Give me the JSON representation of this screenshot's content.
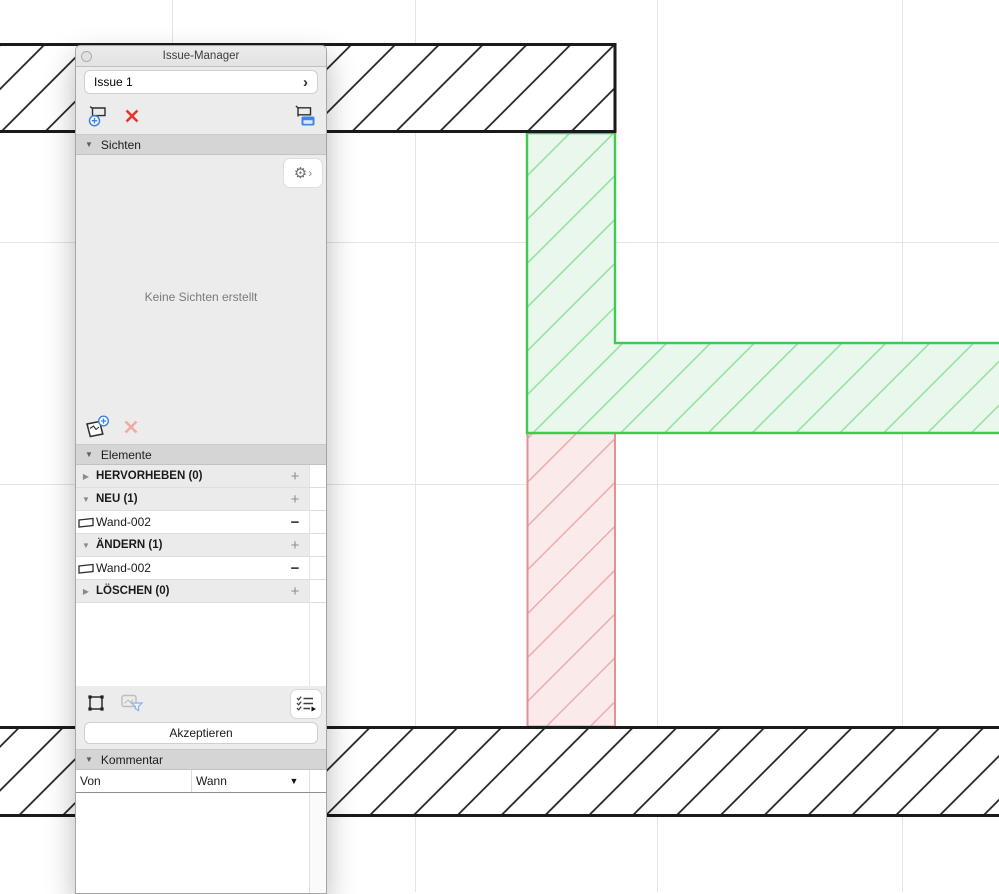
{
  "window": {
    "title": "Issue-Manager"
  },
  "issue": {
    "selected": "Issue 1",
    "chevron": "›"
  },
  "icons": {
    "gear": "⚙",
    "gear_chevron": "›",
    "sort_arrow": "▼"
  },
  "sichten": {
    "label": "Sichten",
    "empty_text": "Keine Sichten erstellt"
  },
  "elemente": {
    "label": "Elemente",
    "rows": [
      {
        "type": "group",
        "label": "HERVORHEBEN (0)",
        "disclosure": "▶",
        "action": "+"
      },
      {
        "type": "group",
        "label": "NEU (1)",
        "disclosure": "▼",
        "action": "+"
      },
      {
        "type": "item",
        "label": "Wand-002",
        "icon": "wall-icon",
        "action": "−"
      },
      {
        "type": "group",
        "label": "ÄNDERN (1)",
        "disclosure": "▼",
        "action": "+"
      },
      {
        "type": "item",
        "label": "Wand-002",
        "icon": "wall-icon",
        "action": "−"
      },
      {
        "type": "group",
        "label": "LÖSCHEN (0)",
        "disclosure": "▶",
        "action": "+"
      }
    ]
  },
  "accept": {
    "label": "Akzeptieren"
  },
  "kommentar": {
    "label": "Kommentar",
    "columns": {
      "von": "Von",
      "wann": "Wann"
    }
  },
  "colors": {
    "accent_blue": "#3b82e0",
    "delete_red": "#e7372a",
    "disabled_red": "#f2aba4",
    "new_green_outline": "#3ecb52",
    "new_green_fill": "#eaf7ec",
    "new_green_hatch": "#8adf99",
    "changed_red_outline": "#e29292",
    "changed_red_fill": "#fbeaea",
    "changed_red_hatch": "#eba6a6",
    "wall_line": "#1a1a1a",
    "grid_line": "#e4e4e4"
  }
}
